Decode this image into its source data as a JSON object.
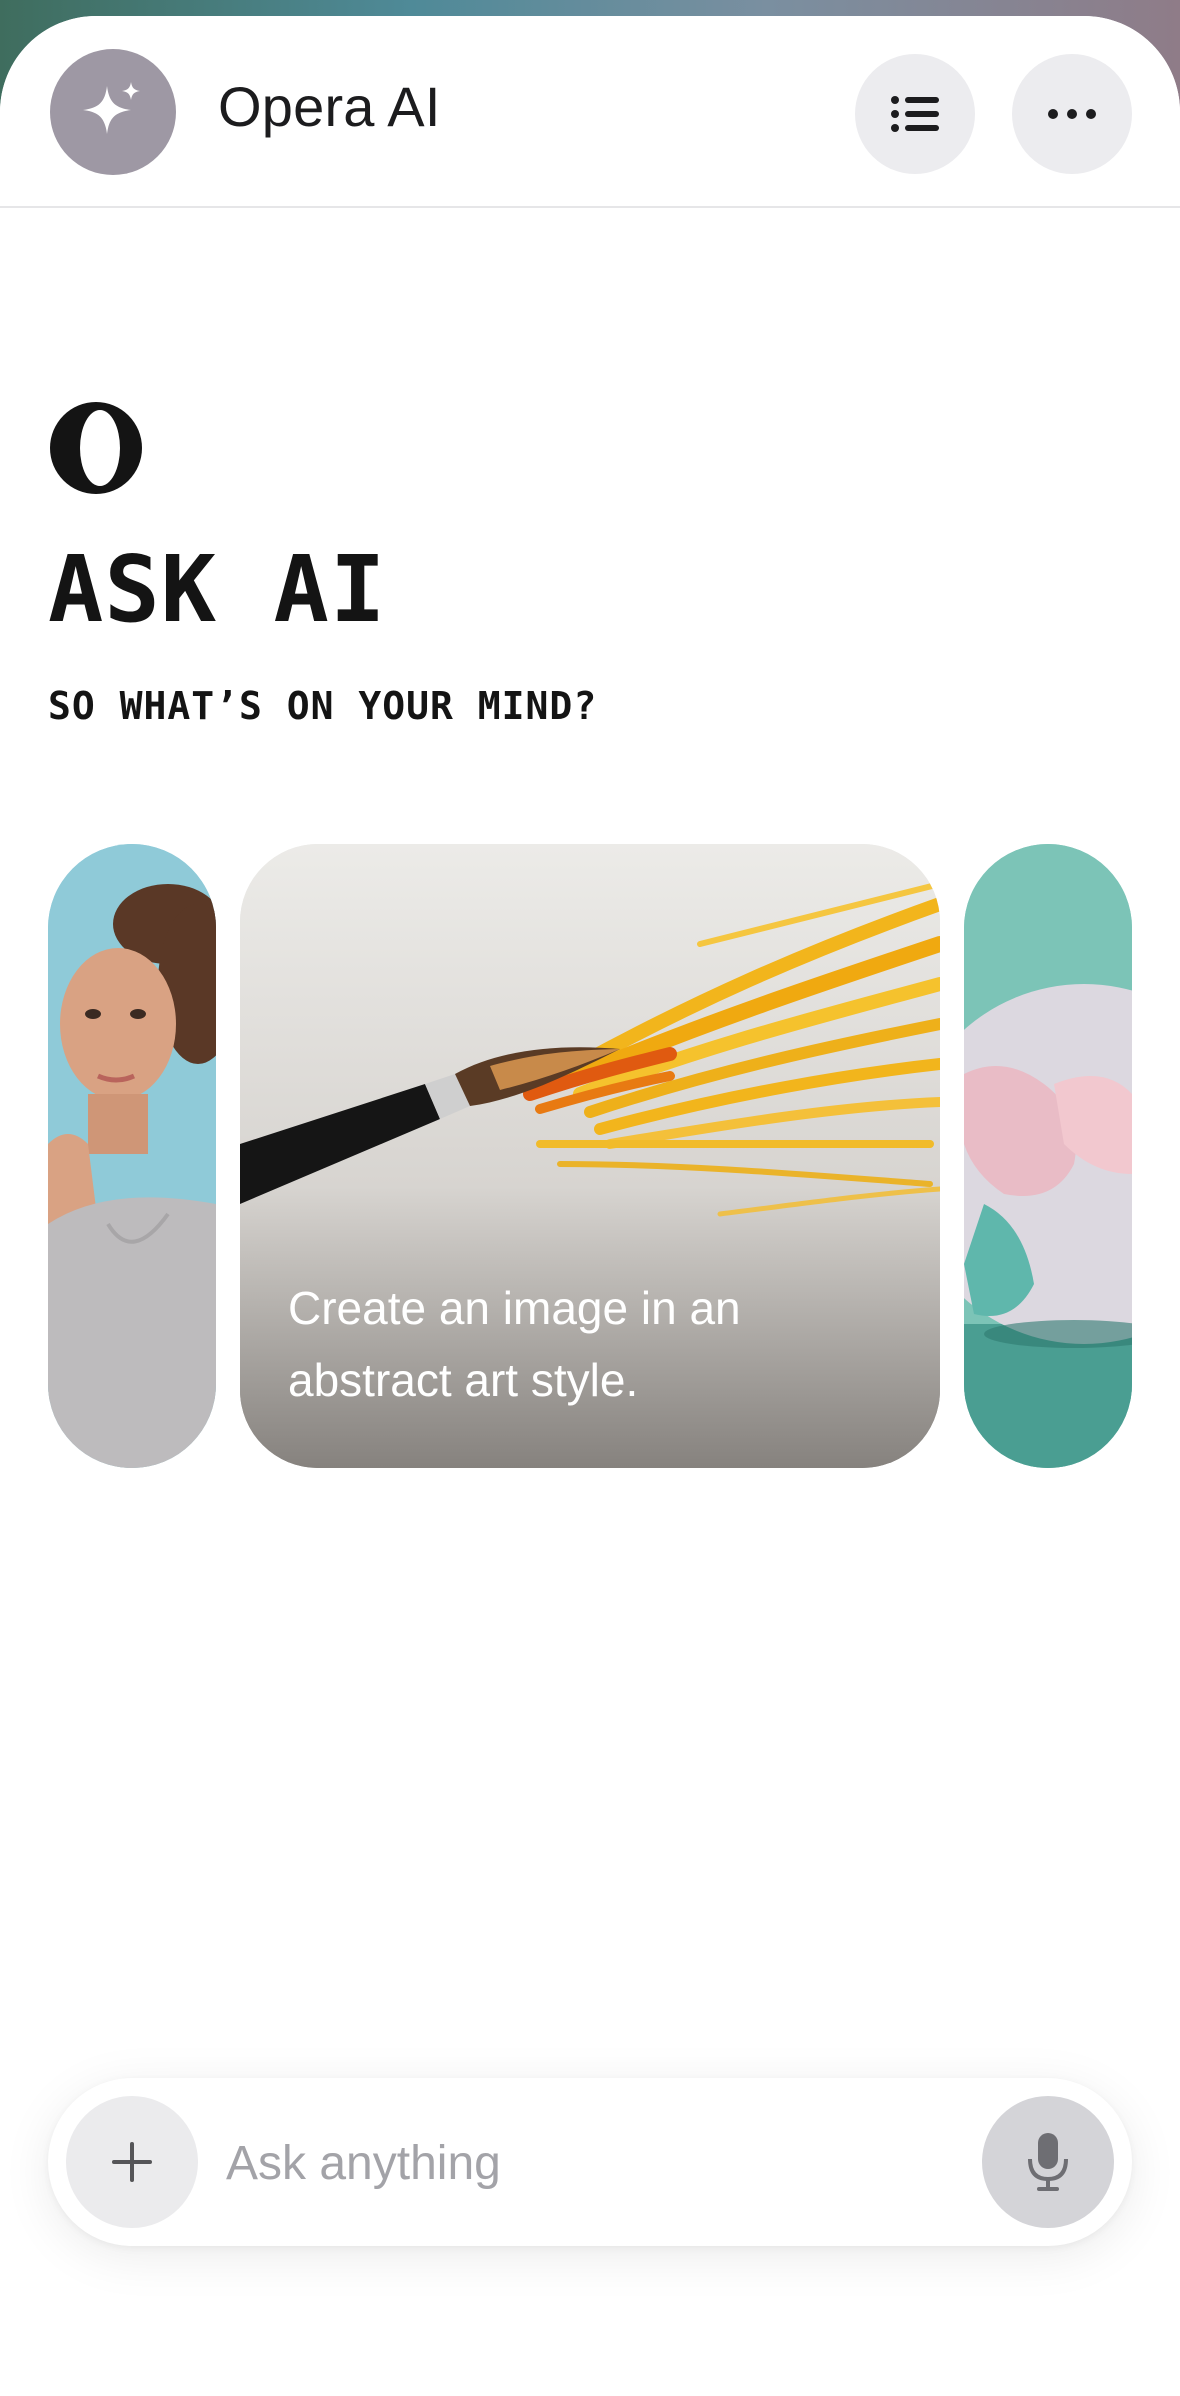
{
  "header": {
    "title": "Opera AI",
    "avatar_icon": "sparkle-icon",
    "list_icon": "list-icon",
    "more_icon": "more-horizontal-icon"
  },
  "hero": {
    "logo_icon": "opera-logo-icon",
    "title": "ASK AI",
    "subtitle": "SO WHAT’S ON YOUR MIND?"
  },
  "cards": [
    {
      "image": "woman-thinking-image"
    },
    {
      "image": "paintbrush-yellow-strokes-image",
      "caption": "Create an image in an abstract art style."
    },
    {
      "image": "globe-image"
    }
  ],
  "input": {
    "placeholder": "Ask anything",
    "plus_icon": "plus-icon",
    "mic_icon": "microphone-icon"
  },
  "colors": {
    "avatar_bg": "#9e98a4",
    "button_bg": "#ececef",
    "mic_bg": "#d4d4d8",
    "accent_yellow": "#f2b51c"
  }
}
